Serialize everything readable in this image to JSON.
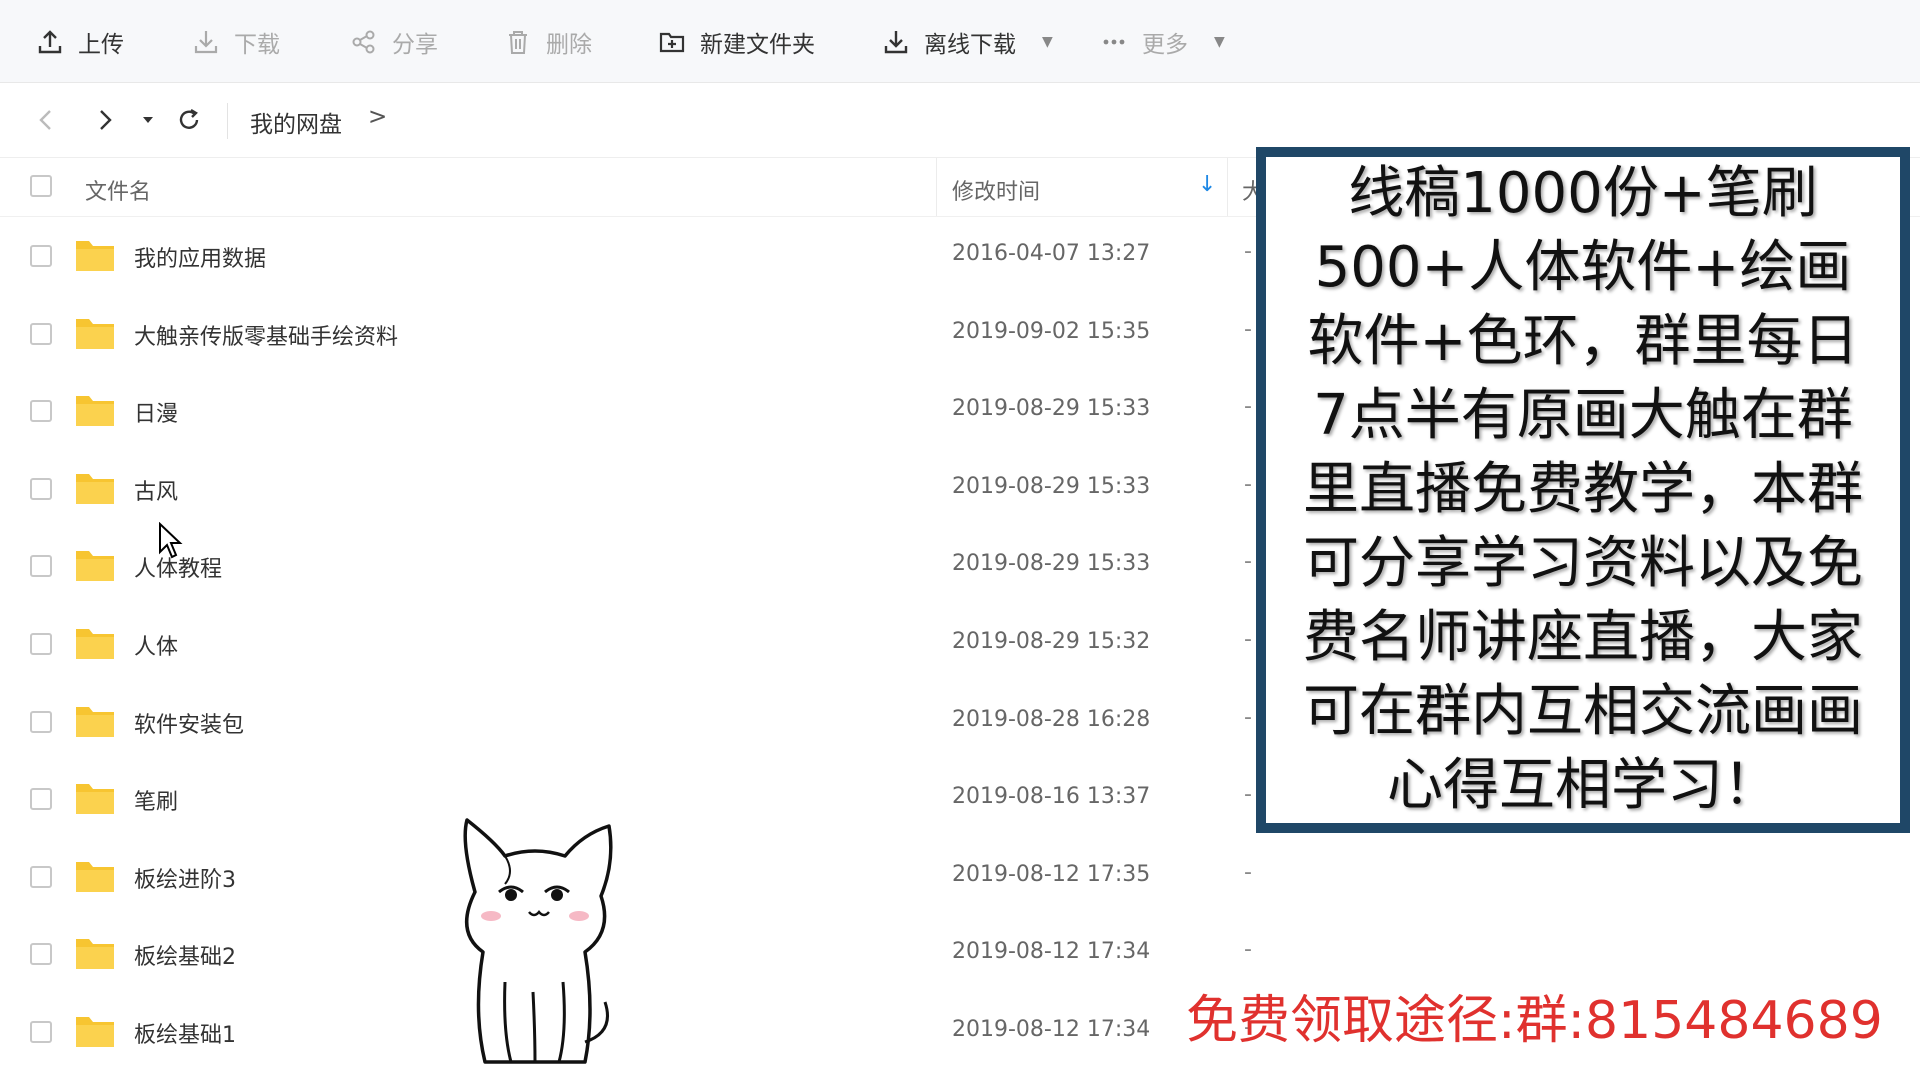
{
  "toolbar": {
    "upload": "上传",
    "download": "下载",
    "share": "分享",
    "delete": "删除",
    "new_folder": "新建文件夹",
    "offline_download": "离线下载",
    "more": "更多"
  },
  "breadcrumb": {
    "root": "我的网盘",
    "arrow": ">"
  },
  "table": {
    "headers": {
      "name": "文件名",
      "modified": "修改时间",
      "size": "大小"
    },
    "sort_icon": "↓",
    "rows": [
      {
        "name": "我的应用数据",
        "modified": "2016-04-07 13:27",
        "size": "-"
      },
      {
        "name": "大触亲传版零基础手绘资料",
        "modified": "2019-09-02 15:35",
        "size": "-"
      },
      {
        "name": "日漫",
        "modified": "2019-08-29 15:33",
        "size": "-"
      },
      {
        "name": "古风",
        "modified": "2019-08-29 15:33",
        "size": "-"
      },
      {
        "name": "人体教程",
        "modified": "2019-08-29 15:33",
        "size": "-"
      },
      {
        "name": "人体",
        "modified": "2019-08-29 15:32",
        "size": "-"
      },
      {
        "name": "软件安装包",
        "modified": "2019-08-28 16:28",
        "size": "-"
      },
      {
        "name": "笔刷",
        "modified": "2019-08-16 13:37",
        "size": "-"
      },
      {
        "name": "板绘进阶3",
        "modified": "2019-08-12 17:35",
        "size": "-"
      },
      {
        "name": "板绘基础2",
        "modified": "2019-08-12 17:34",
        "size": "-"
      },
      {
        "name": "板绘基础1",
        "modified": "2019-08-12 17:34",
        "size": "-"
      }
    ]
  },
  "overlay": {
    "notice": "线稿1000份+笔刷500+人体软件+绘画软件+色环，群里每日7点半有原画大触在群里直播免费教学，本群可分享学习资料以及免费名师讲座直播，大家可在群内互相交流画画心得互相学习！",
    "promo": "免费领取途径:群:815484689"
  },
  "colors": {
    "folder": "#f7c531",
    "notice_border": "#1f4767",
    "promo": "#e0312e",
    "sort_arrow": "#1e88e5"
  },
  "icons": [
    "upload-icon",
    "download-icon",
    "share-icon",
    "delete-icon",
    "new-folder-icon",
    "offline-download-icon",
    "more-icon",
    "back-icon",
    "forward-icon",
    "refresh-icon",
    "folder-icon",
    "mouse-cursor-icon",
    "cat-sticker"
  ]
}
